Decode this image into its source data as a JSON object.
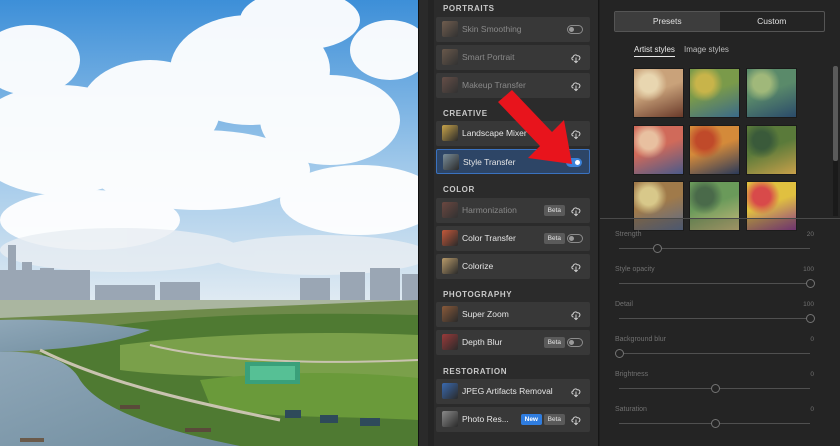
{
  "filters": {
    "sections": [
      {
        "title": "PORTRAITS",
        "items": [
          {
            "label": "Skin Smoothing",
            "thumb": "#b58a6a",
            "dim": true,
            "badge": "",
            "new": false,
            "control": "toggle",
            "on": false
          },
          {
            "label": "Smart Portrait",
            "thumb": "#a58062",
            "dim": true,
            "badge": "",
            "new": false,
            "control": "download",
            "on": false
          },
          {
            "label": "Makeup Transfer",
            "thumb": "#9c6a5a",
            "dim": true,
            "badge": "",
            "new": false,
            "control": "download",
            "on": false
          }
        ]
      },
      {
        "title": "CREATIVE",
        "items": [
          {
            "label": "Landscape Mixer",
            "thumb": "#c8a44a",
            "dim": false,
            "badge": "",
            "new": false,
            "control": "download",
            "on": false
          },
          {
            "label": "Style Transfer",
            "thumb": "#7a8e9a",
            "dim": false,
            "badge": "",
            "new": false,
            "control": "toggle",
            "on": true
          }
        ]
      },
      {
        "title": "COLOR",
        "items": [
          {
            "label": "Harmonization",
            "thumb": "#a85a4a",
            "dim": true,
            "badge": "Beta",
            "new": false,
            "control": "download",
            "on": false
          },
          {
            "label": "Color Transfer",
            "thumb": "#c4583a",
            "dim": false,
            "badge": "Beta",
            "new": false,
            "control": "toggle",
            "on": false
          },
          {
            "label": "Colorize",
            "thumb": "#b89a6a",
            "dim": false,
            "badge": "",
            "new": false,
            "control": "download",
            "on": false
          }
        ]
      },
      {
        "title": "PHOTOGRAPHY",
        "items": [
          {
            "label": "Super Zoom",
            "thumb": "#8a5a3a",
            "dim": false,
            "badge": "",
            "new": false,
            "control": "download",
            "on": false
          },
          {
            "label": "Depth Blur",
            "thumb": "#9a3a3a",
            "dim": false,
            "badge": "Beta",
            "new": false,
            "control": "toggle",
            "on": false
          }
        ]
      },
      {
        "title": "RESTORATION",
        "items": [
          {
            "label": "JPEG Artifacts Removal",
            "thumb": "#3a6ab0",
            "dim": false,
            "badge": "",
            "new": false,
            "control": "download",
            "on": false
          },
          {
            "label": "Photo Res...",
            "thumb": "#8a8a8a",
            "dim": false,
            "badge": "Beta",
            "new": true,
            "control": "download",
            "on": false
          }
        ]
      }
    ],
    "new_label": "New"
  },
  "settings": {
    "segments": [
      {
        "label": "Presets",
        "selected": true
      },
      {
        "label": "Custom",
        "selected": false
      }
    ],
    "style_tabs": [
      {
        "label": "Artist styles",
        "selected": true
      },
      {
        "label": "Image styles",
        "selected": false
      }
    ],
    "artworks": [
      {
        "name": "mountain-artwork",
        "c1": "#c9a27a",
        "c2": "#6a3a2a",
        "c3": "#e8d6b0"
      },
      {
        "name": "fields-artwork",
        "c1": "#7a9a4a",
        "c2": "#3a6a8a",
        "c3": "#c8b44a"
      },
      {
        "name": "cottage-artwork",
        "c1": "#5a8a6a",
        "c2": "#2a4a6a",
        "c3": "#a0b87a"
      },
      {
        "name": "peaks-artwork",
        "c1": "#d06a5a",
        "c2": "#4a5a8a",
        "c3": "#e8c0a0"
      },
      {
        "name": "scream-artwork",
        "c1": "#d48a3a",
        "c2": "#2a3a5a",
        "c3": "#c04a2a"
      },
      {
        "name": "cafe-artwork",
        "c1": "#5a7a3a",
        "c2": "#c8a04a",
        "c3": "#3a5a3a"
      },
      {
        "name": "stilllife-artwork",
        "c1": "#a07a4a",
        "c2": "#5a6a8a",
        "c3": "#d8c88a"
      },
      {
        "name": "village-artwork",
        "c1": "#6a9a5a",
        "c2": "#c8b87a",
        "c3": "#4a6a4a"
      },
      {
        "name": "abstract-artwork",
        "c1": "#e0c040",
        "c2": "#8a3a8a",
        "c3": "#d84a4a"
      }
    ],
    "sliders": [
      {
        "label": "Strength",
        "value": "20",
        "fraction": 0.2
      },
      {
        "label": "Style opacity",
        "value": "100",
        "fraction": 1.0
      },
      {
        "label": "Detail",
        "value": "100",
        "fraction": 1.0
      },
      {
        "label": "Background blur",
        "value": "0",
        "fraction": 0.0
      },
      {
        "label": "Brightness",
        "value": "0",
        "fraction": 0.5
      },
      {
        "label": "Saturation",
        "value": "0",
        "fraction": 0.5
      }
    ]
  },
  "colors": {
    "accent": "#3b82d9",
    "annotation_arrow": "#e8141c"
  }
}
